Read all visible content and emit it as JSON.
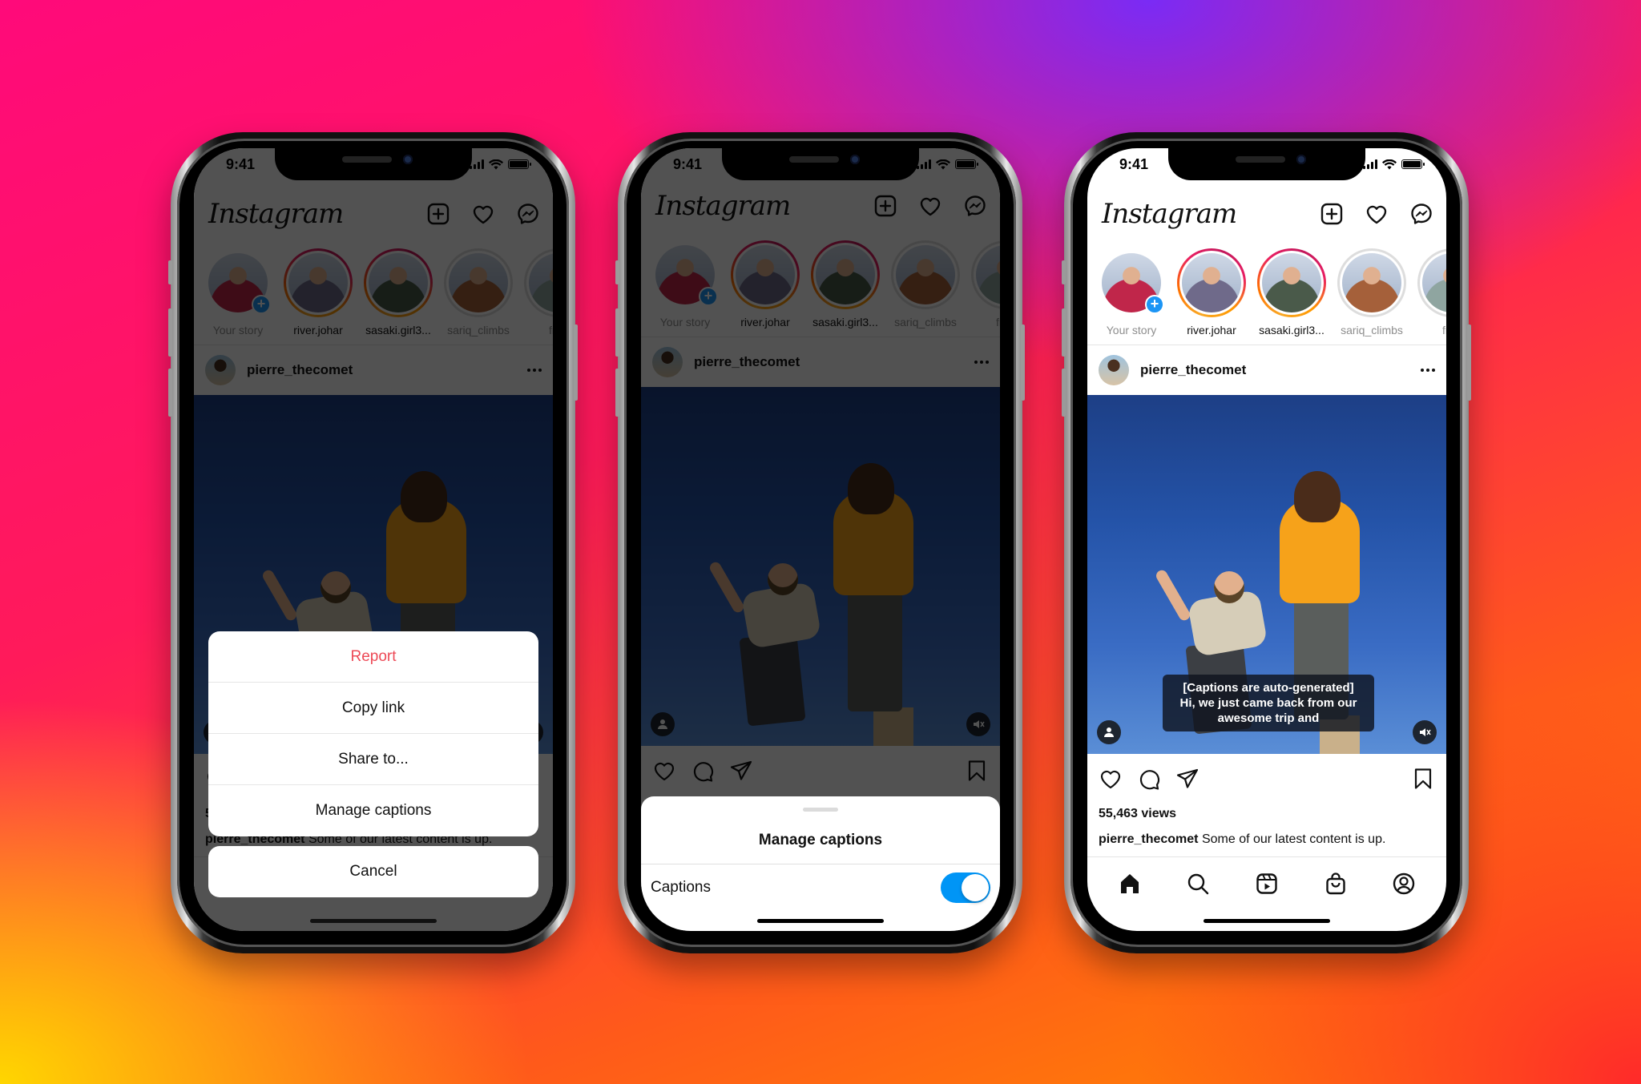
{
  "status_bar": {
    "time": "9:41"
  },
  "app": {
    "logo": "Instagram"
  },
  "header_icons": [
    "new-post-icon",
    "heart-icon",
    "messenger-icon"
  ],
  "stories": [
    {
      "label": "Your story",
      "type": "own",
      "muted": true,
      "color": "#c0264a"
    },
    {
      "label": "river.johar",
      "type": "active",
      "muted": false,
      "color": "#6f6a8a"
    },
    {
      "label": "sasaki.girl3...",
      "type": "active",
      "muted": false,
      "color": "#4a5a4a"
    },
    {
      "label": "sariq_climbs",
      "type": "seen",
      "muted": true,
      "color": "#a5603a"
    },
    {
      "label": "fren",
      "type": "seen",
      "muted": true,
      "color": "#8fa5a0"
    }
  ],
  "post": {
    "username": "pierre_thecomet",
    "views": "55,463 views",
    "caption_user": "pierre_thecomet",
    "caption_text": "Some of our latest content is up.",
    "auto_captions": [
      "[Captions are auto-generated]",
      "Hi, we just came back from our",
      "awesome trip and"
    ]
  },
  "action_sheet": {
    "items": [
      {
        "label": "Report",
        "danger": true
      },
      {
        "label": "Copy link",
        "danger": false
      },
      {
        "label": "Share to...",
        "danger": false
      },
      {
        "label": "Manage captions",
        "danger": false
      }
    ],
    "cancel": "Cancel"
  },
  "captions_sheet": {
    "title": "Manage captions",
    "row_label": "Captions",
    "toggle_on": true
  },
  "tabbar": [
    "home-icon",
    "search-icon",
    "reels-icon",
    "shop-icon",
    "profile-icon"
  ],
  "colors": {
    "danger": "#ed4956",
    "toggle": "#0095f6",
    "story_add": "#1c95f5"
  }
}
